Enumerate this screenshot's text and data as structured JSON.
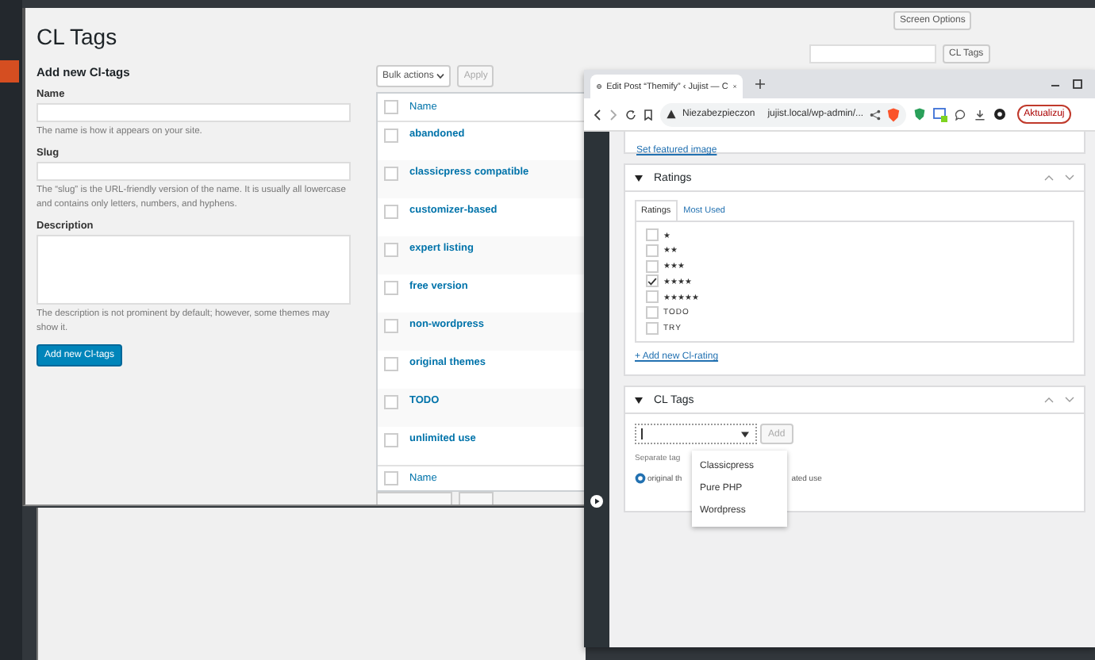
{
  "admin_page": {
    "title": "CL Tags",
    "screen_options": "Screen Options",
    "search_button": "CL Tags",
    "form": {
      "heading": "Add new Cl-tags",
      "fields": [
        {
          "label": "Name",
          "kind": "input",
          "help": "The name is how it appears on your site."
        },
        {
          "label": "Slug",
          "kind": "input",
          "help": "The “slug” is the URL-friendly version of the name. It is usually all lowercase and contains only letters, numbers, and hyphens."
        },
        {
          "label": "Description",
          "kind": "textarea",
          "help": "The description is not prominent by default; however, some themes may show it."
        }
      ],
      "submit": "Add new Cl-tags"
    },
    "table": {
      "bulk_actions": "Bulk actions",
      "apply": "Apply",
      "column": "Name",
      "footer_column": "Name",
      "select_all_checked": false,
      "rows": [
        {
          "name": "abandoned",
          "checked": false
        },
        {
          "name": "classicpress compatible",
          "checked": false
        },
        {
          "name": "customizer-based",
          "checked": false
        },
        {
          "name": "expert listing",
          "checked": false
        },
        {
          "name": "free version",
          "checked": false
        },
        {
          "name": "non-wordpress",
          "checked": false
        },
        {
          "name": "original themes",
          "checked": false
        },
        {
          "name": "TODO",
          "checked": false
        },
        {
          "name": "unlimited use",
          "checked": false
        }
      ]
    }
  },
  "browser": {
    "tab_title": "Edit Post “Themify” ‹ Jujist — C",
    "security": "Niezabezpieczon",
    "url": "jujist.local/wp-admin/...",
    "update_button": "Aktualizuj",
    "editor": {
      "featured_link": "Set featured image",
      "ratings": {
        "title": "Ratings",
        "tabs": [
          {
            "label": "Ratings",
            "selected": true
          },
          {
            "label": "Most Used",
            "selected": false
          }
        ],
        "items": [
          {
            "label": "★",
            "checked": false
          },
          {
            "label": "★★",
            "checked": false
          },
          {
            "label": "★★★",
            "checked": false
          },
          {
            "label": "★★★★",
            "checked": true
          },
          {
            "label": "★★★★★",
            "checked": false
          },
          {
            "label": "TODO",
            "checked": false
          },
          {
            "label": "TRY",
            "checked": false
          }
        ],
        "add_link": "+ Add new Cl-rating"
      },
      "cl_tags": {
        "title": "CL Tags",
        "add_button": "Add",
        "hint": "Separate tag",
        "tag_start": "original th",
        "tag_end": "ated use",
        "options": [
          "Classicpress",
          "Pure PHP",
          "Wordpress"
        ]
      }
    }
  }
}
